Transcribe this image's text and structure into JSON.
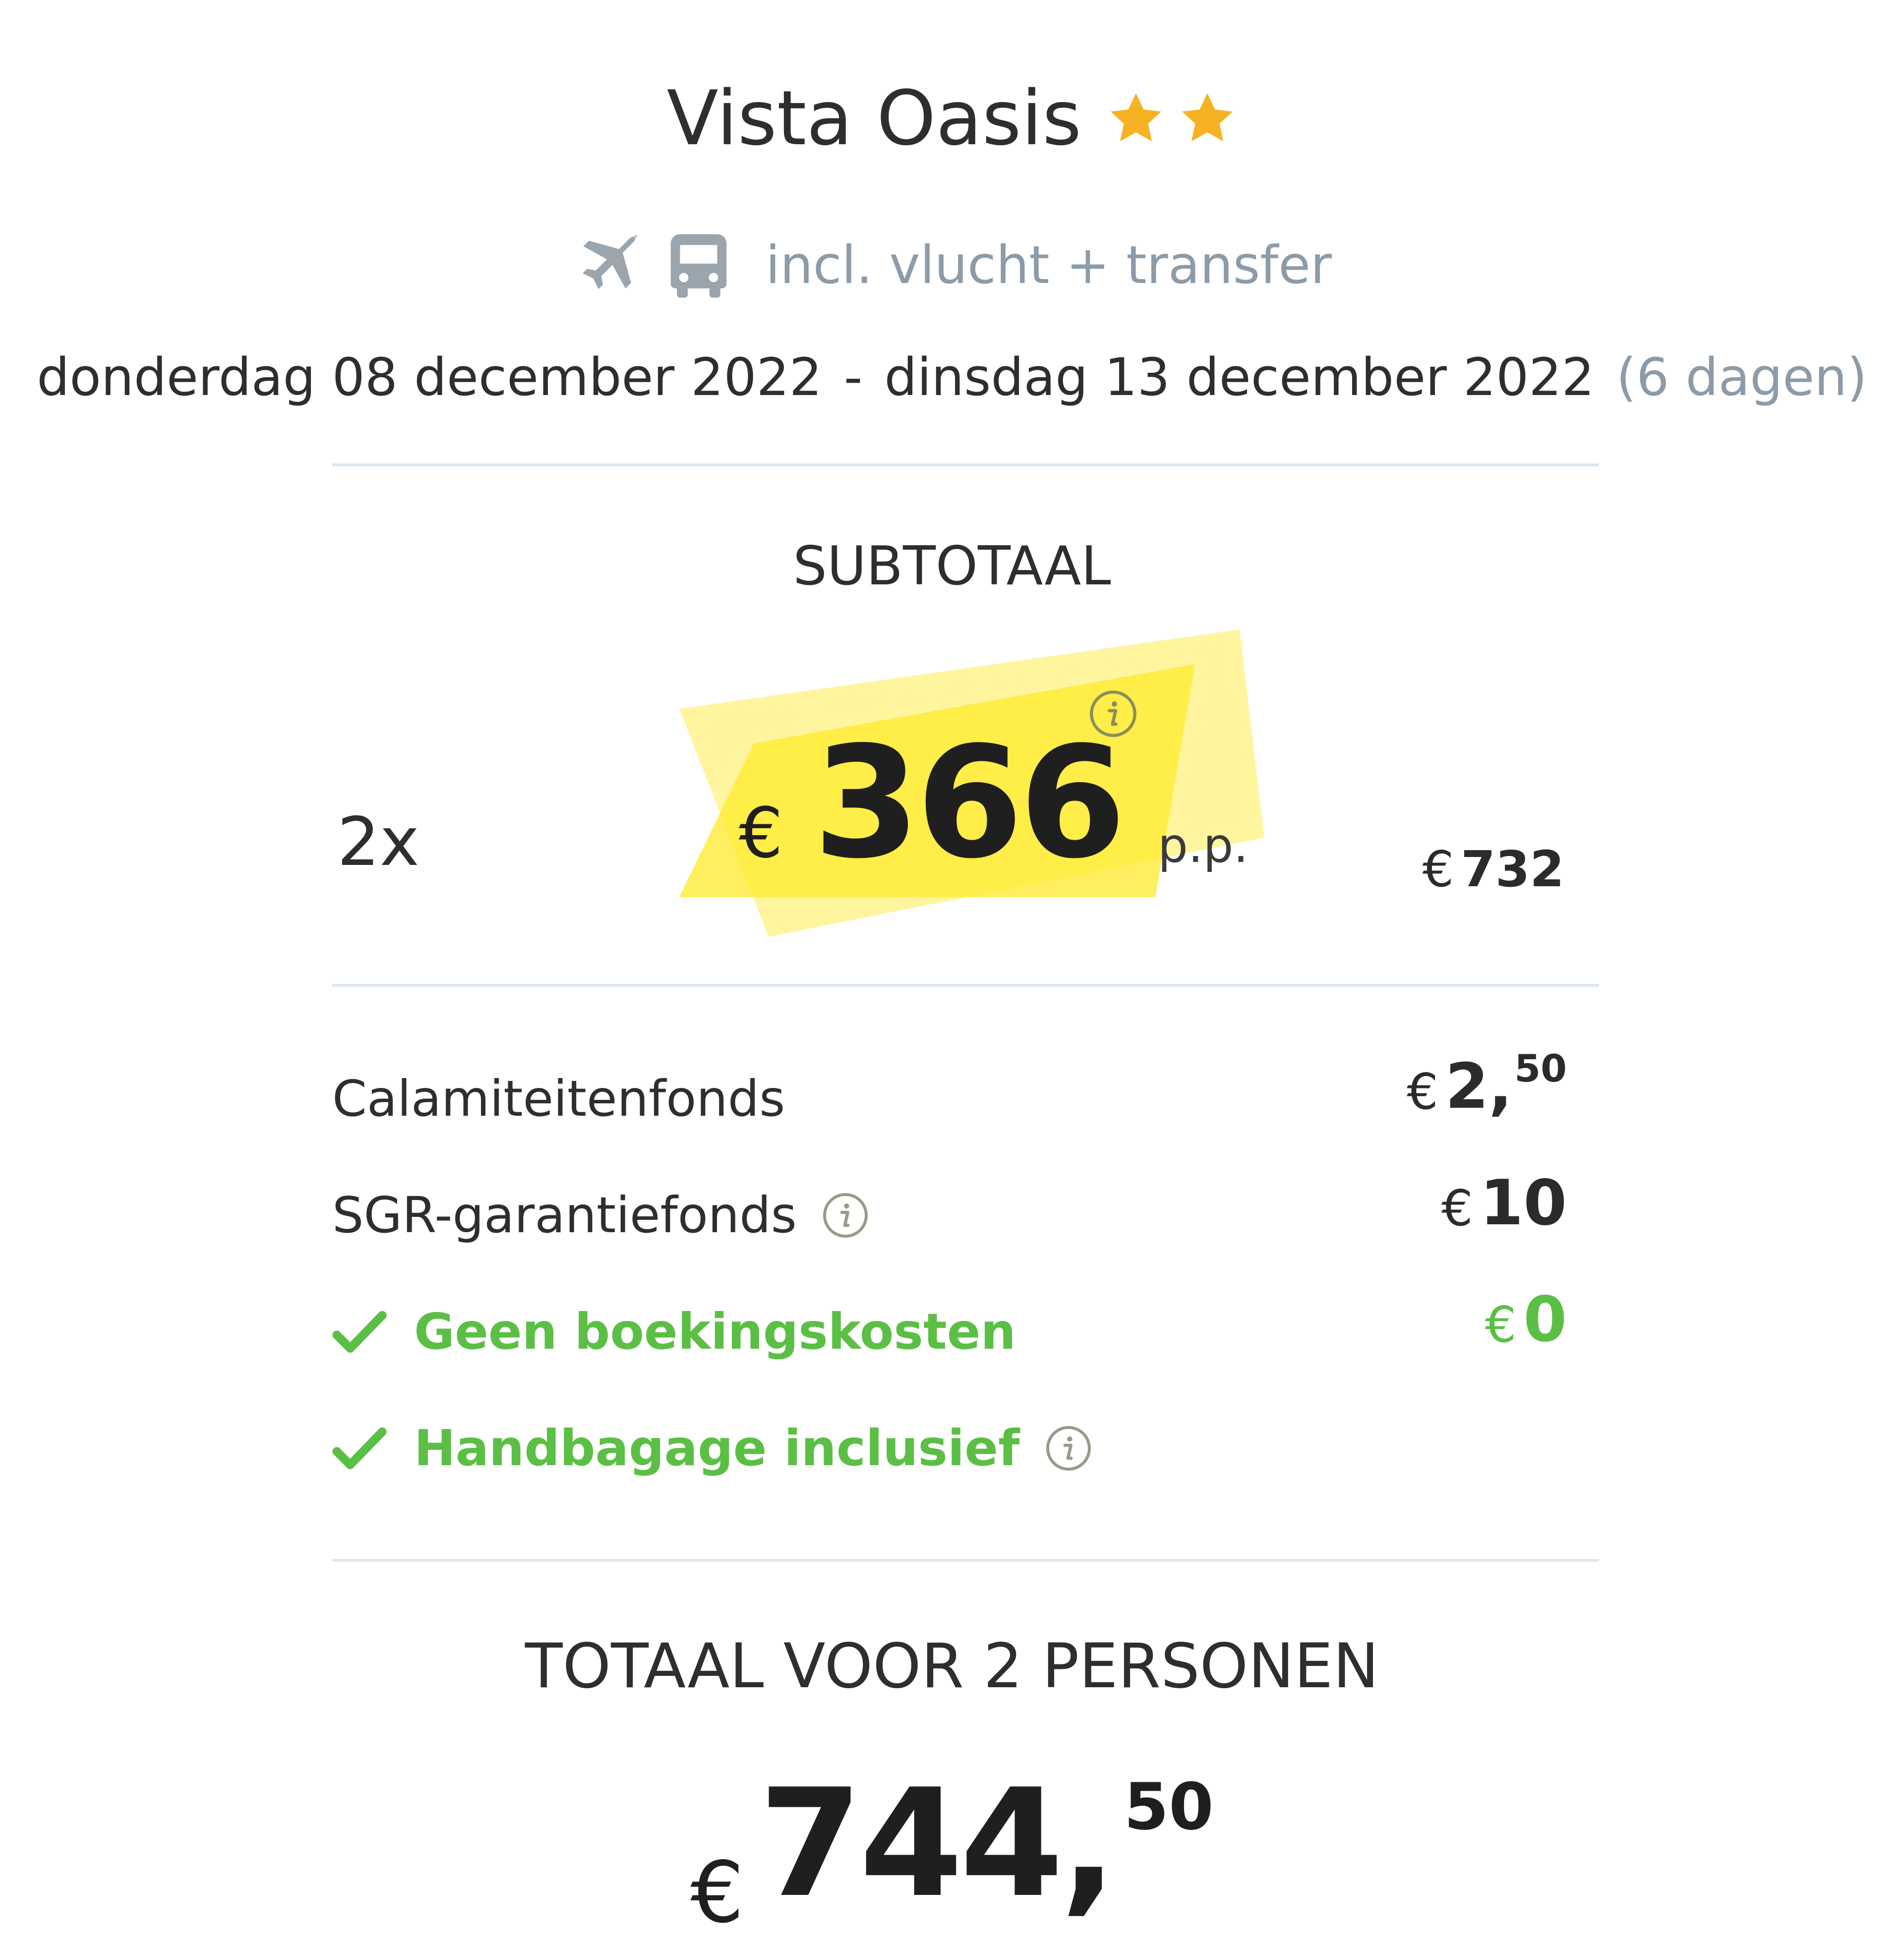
{
  "hotel": {
    "name": "Vista Oasis",
    "stars": 2,
    "star_color": "#f6b223"
  },
  "package": {
    "includes_text": "incl. vlucht + transfer",
    "icons": [
      "airplane-icon",
      "bus-icon"
    ],
    "icon_color": "#9aa5ae"
  },
  "dates": {
    "departure": "donderdag 08 december 2022",
    "separator": "-",
    "return": "dinsdag 13 december 2022",
    "duration": "(6 dagen)"
  },
  "subtotal": {
    "title": "SUBTOTAAL",
    "quantity": "2x",
    "currency": "€",
    "price_per_person": "366",
    "per_person_label": "p.p.",
    "subtotal_currency": "€",
    "subtotal_amount": "732",
    "highlight_color": "#ffe92b"
  },
  "fees": [
    {
      "label": "Calamiteitenfonds",
      "currency": "€",
      "amount": "2,",
      "cents": "50"
    },
    {
      "label": "SGR-garantiefonds",
      "currency": "€",
      "amount": "10",
      "cents": ""
    }
  ],
  "perks": [
    {
      "label": "Geen boekingskosten",
      "currency": "€",
      "amount": "0"
    },
    {
      "label": "Handbagage inclusief"
    }
  ],
  "accent_green": "#5cbf45",
  "total": {
    "title": "TOTAAL VOOR 2 PERSONEN",
    "currency": "€",
    "amount": "744,",
    "cents": "50"
  }
}
